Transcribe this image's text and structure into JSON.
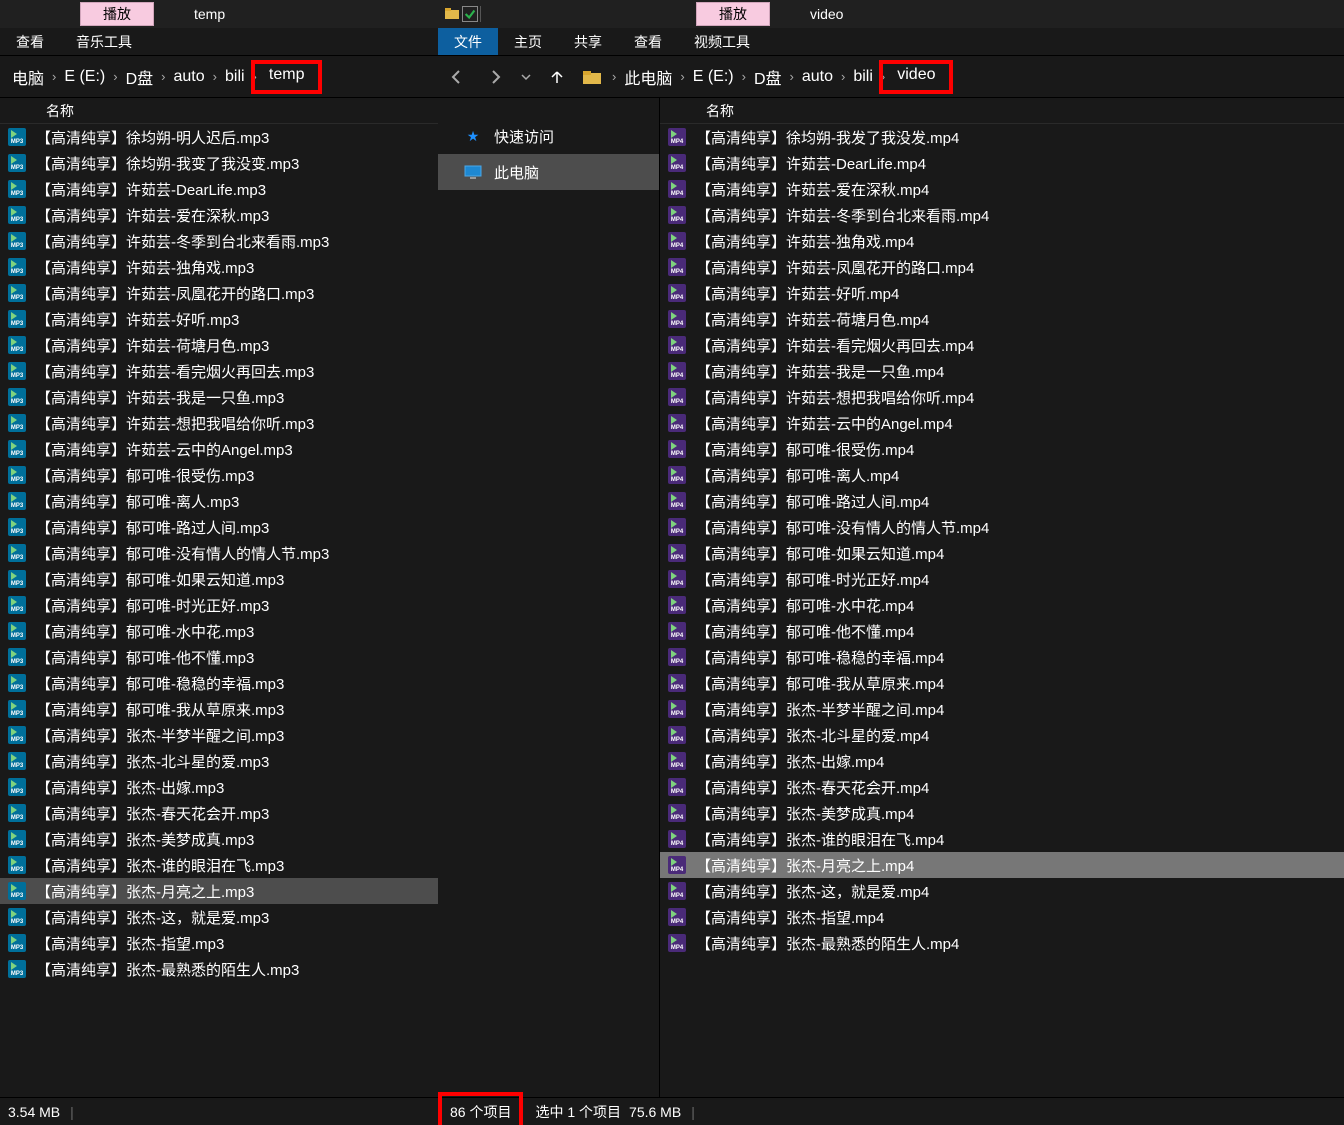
{
  "left": {
    "titlebar": {
      "play": "播放",
      "title": "temp"
    },
    "ribbon": {
      "view": "查看",
      "music_tools": "音乐工具"
    },
    "breadcrumb": {
      "parts": [
        "电脑",
        "E (E:)",
        "D盘",
        "auto",
        "bili"
      ],
      "last": "temp"
    },
    "col_header": "名称",
    "files": [
      {
        "name": "【高清纯享】徐均朔-明人迟后.mp3",
        "sel": false
      },
      {
        "name": "【高清纯享】徐均朔-我变了我没变.mp3",
        "sel": false
      },
      {
        "name": "【高清纯享】许茹芸-DearLife.mp3",
        "sel": false
      },
      {
        "name": "【高清纯享】许茹芸-爱在深秋.mp3",
        "sel": false
      },
      {
        "name": "【高清纯享】许茹芸-冬季到台北来看雨.mp3",
        "sel": false
      },
      {
        "name": "【高清纯享】许茹芸-独角戏.mp3",
        "sel": false
      },
      {
        "name": "【高清纯享】许茹芸-凤凰花开的路口.mp3",
        "sel": false
      },
      {
        "name": "【高清纯享】许茹芸-好听.mp3",
        "sel": false
      },
      {
        "name": "【高清纯享】许茹芸-荷塘月色.mp3",
        "sel": false
      },
      {
        "name": "【高清纯享】许茹芸-看完烟火再回去.mp3",
        "sel": false
      },
      {
        "name": "【高清纯享】许茹芸-我是一只鱼.mp3",
        "sel": false
      },
      {
        "name": "【高清纯享】许茹芸-想把我唱给你听.mp3",
        "sel": false
      },
      {
        "name": "【高清纯享】许茹芸-云中的Angel.mp3",
        "sel": false
      },
      {
        "name": "【高清纯享】郁可唯-很受伤.mp3",
        "sel": false
      },
      {
        "name": "【高清纯享】郁可唯-离人.mp3",
        "sel": false
      },
      {
        "name": "【高清纯享】郁可唯-路过人间.mp3",
        "sel": false
      },
      {
        "name": "【高清纯享】郁可唯-没有情人的情人节.mp3",
        "sel": false
      },
      {
        "name": "【高清纯享】郁可唯-如果云知道.mp3",
        "sel": false
      },
      {
        "name": "【高清纯享】郁可唯-时光正好.mp3",
        "sel": false
      },
      {
        "name": "【高清纯享】郁可唯-水中花.mp3",
        "sel": false
      },
      {
        "name": "【高清纯享】郁可唯-他不懂.mp3",
        "sel": false
      },
      {
        "name": "【高清纯享】郁可唯-稳稳的幸福.mp3",
        "sel": false
      },
      {
        "name": "【高清纯享】郁可唯-我从草原来.mp3",
        "sel": false
      },
      {
        "name": "【高清纯享】张杰-半梦半醒之间.mp3",
        "sel": false
      },
      {
        "name": "【高清纯享】张杰-北斗星的爱.mp3",
        "sel": false
      },
      {
        "name": "【高清纯享】张杰-出嫁.mp3",
        "sel": false
      },
      {
        "name": "【高清纯享】张杰-春天花会开.mp3",
        "sel": false
      },
      {
        "name": "【高清纯享】张杰-美梦成真.mp3",
        "sel": false
      },
      {
        "name": "【高清纯享】张杰-谁的眼泪在飞.mp3",
        "sel": false
      },
      {
        "name": "【高清纯享】张杰-月亮之上.mp3",
        "sel": true
      },
      {
        "name": "【高清纯享】张杰-这，就是爱.mp3",
        "sel": false
      },
      {
        "name": "【高清纯享】张杰-指望.mp3",
        "sel": false
      },
      {
        "name": "【高清纯享】张杰-最熟悉的陌生人.mp3",
        "sel": false
      }
    ],
    "status": {
      "size": "3.54 MB"
    }
  },
  "right": {
    "titlebar": {
      "play": "播放",
      "title": "video"
    },
    "ribbon": {
      "file": "文件",
      "home": "主页",
      "share": "共享",
      "view": "查看",
      "video_tools": "视频工具"
    },
    "breadcrumb": {
      "parts": [
        "此电脑",
        "E (E:)",
        "D盘",
        "auto",
        "bili"
      ],
      "last": "video"
    },
    "nav": {
      "quick": "快速访问",
      "thispc": "此电脑"
    },
    "col_header": "名称",
    "files": [
      {
        "name": "【高清纯享】徐均朔-我发了我没发.mp4",
        "sel": false
      },
      {
        "name": "【高清纯享】许茹芸-DearLife.mp4",
        "sel": false
      },
      {
        "name": "【高清纯享】许茹芸-爱在深秋.mp4",
        "sel": false
      },
      {
        "name": "【高清纯享】许茹芸-冬季到台北来看雨.mp4",
        "sel": false
      },
      {
        "name": "【高清纯享】许茹芸-独角戏.mp4",
        "sel": false
      },
      {
        "name": "【高清纯享】许茹芸-凤凰花开的路口.mp4",
        "sel": false
      },
      {
        "name": "【高清纯享】许茹芸-好听.mp4",
        "sel": false
      },
      {
        "name": "【高清纯享】许茹芸-荷塘月色.mp4",
        "sel": false
      },
      {
        "name": "【高清纯享】许茹芸-看完烟火再回去.mp4",
        "sel": false
      },
      {
        "name": "【高清纯享】许茹芸-我是一只鱼.mp4",
        "sel": false
      },
      {
        "name": "【高清纯享】许茹芸-想把我唱给你听.mp4",
        "sel": false
      },
      {
        "name": "【高清纯享】许茹芸-云中的Angel.mp4",
        "sel": false
      },
      {
        "name": "【高清纯享】郁可唯-很受伤.mp4",
        "sel": false
      },
      {
        "name": "【高清纯享】郁可唯-离人.mp4",
        "sel": false
      },
      {
        "name": "【高清纯享】郁可唯-路过人间.mp4",
        "sel": false
      },
      {
        "name": "【高清纯享】郁可唯-没有情人的情人节.mp4",
        "sel": false
      },
      {
        "name": "【高清纯享】郁可唯-如果云知道.mp4",
        "sel": false
      },
      {
        "name": "【高清纯享】郁可唯-时光正好.mp4",
        "sel": false
      },
      {
        "name": "【高清纯享】郁可唯-水中花.mp4",
        "sel": false
      },
      {
        "name": "【高清纯享】郁可唯-他不懂.mp4",
        "sel": false
      },
      {
        "name": "【高清纯享】郁可唯-稳稳的幸福.mp4",
        "sel": false
      },
      {
        "name": "【高清纯享】郁可唯-我从草原来.mp4",
        "sel": false
      },
      {
        "name": "【高清纯享】张杰-半梦半醒之间.mp4",
        "sel": false
      },
      {
        "name": "【高清纯享】张杰-北斗星的爱.mp4",
        "sel": false
      },
      {
        "name": "【高清纯享】张杰-出嫁.mp4",
        "sel": false
      },
      {
        "name": "【高清纯享】张杰-春天花会开.mp4",
        "sel": false
      },
      {
        "name": "【高清纯享】张杰-美梦成真.mp4",
        "sel": false
      },
      {
        "name": "【高清纯享】张杰-谁的眼泪在飞.mp4",
        "sel": false
      },
      {
        "name": "【高清纯享】张杰-月亮之上.mp4",
        "sel": true
      },
      {
        "name": "【高清纯享】张杰-这，就是爱.mp4",
        "sel": false
      },
      {
        "name": "【高清纯享】张杰-指望.mp4",
        "sel": false
      },
      {
        "name": "【高清纯享】张杰-最熟悉的陌生人.mp4",
        "sel": false
      }
    ],
    "status": {
      "count": "86 个项目",
      "selected": "选中 1 个项目",
      "size": "75.6 MB"
    }
  }
}
